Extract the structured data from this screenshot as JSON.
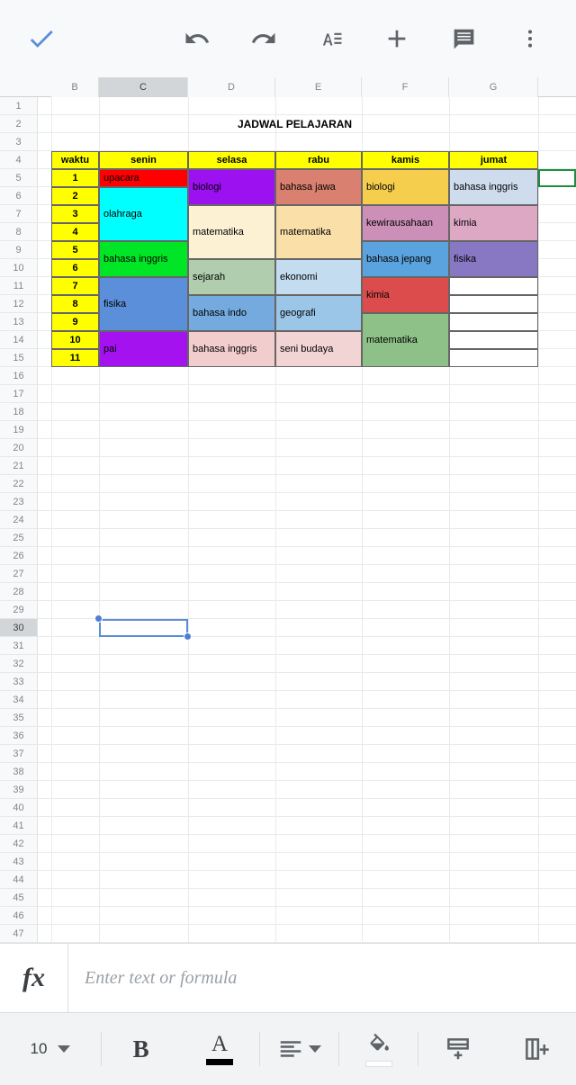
{
  "topbar": {
    "confirm_label": "check-icon",
    "actions": [
      {
        "name": "undo",
        "label": "undo-icon"
      },
      {
        "name": "redo",
        "label": "redo-icon"
      },
      {
        "name": "format",
        "label": "text-format-icon"
      },
      {
        "name": "insert",
        "label": "plus-icon"
      },
      {
        "name": "comment",
        "label": "comment-icon"
      },
      {
        "name": "more",
        "label": "more-vertical-icon"
      }
    ]
  },
  "grid": {
    "columns": [
      "B",
      "C",
      "D",
      "E",
      "F",
      "G"
    ],
    "selected_column": "C",
    "selected_row": 30,
    "first_row": 1,
    "last_row": 47,
    "title": "JADWAL PELAJARAN",
    "title_row": 2,
    "active_cell_ref": "H5"
  },
  "schedule": {
    "headers": [
      "waktu",
      "senin",
      "selasa",
      "rabu",
      "kamis",
      "jumat"
    ],
    "header_bg": "#ffff00",
    "periods": [
      "1",
      "2",
      "3",
      "4",
      "5",
      "6",
      "7",
      "8",
      "9",
      "10",
      "11"
    ],
    "period_bg": "#ffff00",
    "columns": [
      {
        "day": "senin",
        "blocks": [
          {
            "text": "upacara",
            "start": 1,
            "span": 1,
            "bg": "#ff0000"
          },
          {
            "text": "olahraga",
            "start": 2,
            "span": 3,
            "bg": "#00ffff"
          },
          {
            "text": "bahasa inggris",
            "start": 5,
            "span": 2,
            "bg": "#00e525"
          },
          {
            "text": "fisika",
            "start": 7,
            "span": 3,
            "bg": "#5b8fd9"
          },
          {
            "text": "pai",
            "start": 10,
            "span": 2,
            "bg": "#a512f0"
          }
        ]
      },
      {
        "day": "selasa",
        "blocks": [
          {
            "text": "biologi",
            "start": 1,
            "span": 2,
            "bg": "#9b11f0"
          },
          {
            "text": "matematika",
            "start": 3,
            "span": 3,
            "bg": "#fdf1d4"
          },
          {
            "text": "sejarah",
            "start": 6,
            "span": 2,
            "bg": "#b0cdae"
          },
          {
            "text": "bahasa indo",
            "start": 8,
            "span": 2,
            "bg": "#74aade"
          },
          {
            "text": "bahasa inggris",
            "start": 10,
            "span": 2,
            "bg": "#f2cdcd"
          }
        ]
      },
      {
        "day": "rabu",
        "blocks": [
          {
            "text": "bahasa jawa",
            "start": 1,
            "span": 2,
            "bg": "#d98070"
          },
          {
            "text": "matematika",
            "start": 3,
            "span": 3,
            "bg": "#fae0a8"
          },
          {
            "text": "ekonomi",
            "start": 6,
            "span": 2,
            "bg": "#c3dcf0"
          },
          {
            "text": "geografi",
            "start": 8,
            "span": 2,
            "bg": "#9bc6e8"
          },
          {
            "text": "seni budaya",
            "start": 10,
            "span": 2,
            "bg": "#f2d4d4"
          }
        ]
      },
      {
        "day": "kamis",
        "blocks": [
          {
            "text": "biologi",
            "start": 1,
            "span": 2,
            "bg": "#f5ce4e"
          },
          {
            "text": "kewirausahaan",
            "start": 3,
            "span": 2,
            "bg": "#cc8fb8"
          },
          {
            "text": "bahasa jepang",
            "start": 5,
            "span": 2,
            "bg": "#5ba3de"
          },
          {
            "text": "kimia",
            "start": 7,
            "span": 2,
            "bg": "#dd4c4c"
          },
          {
            "text": "matematika",
            "start": 9,
            "span": 3,
            "bg": "#8ec188"
          }
        ]
      },
      {
        "day": "jumat",
        "blocks": [
          {
            "text": "bahasa inggris",
            "start": 1,
            "span": 2,
            "bg": "#cfdcee"
          },
          {
            "text": "kimia",
            "start": 3,
            "span": 2,
            "bg": "#dda8c4"
          },
          {
            "text": "fisika",
            "start": 5,
            "span": 2,
            "bg": "#8878c4"
          },
          {
            "text": "",
            "start": 7,
            "span": 1,
            "bg": "#ffffff"
          },
          {
            "text": "",
            "start": 8,
            "span": 1,
            "bg": "#ffffff"
          },
          {
            "text": "",
            "start": 9,
            "span": 1,
            "bg": "#ffffff"
          },
          {
            "text": "",
            "start": 10,
            "span": 1,
            "bg": "#ffffff"
          },
          {
            "text": "",
            "start": 11,
            "span": 1,
            "bg": "#ffffff"
          }
        ]
      }
    ]
  },
  "formula_bar": {
    "fx_label": "fx",
    "value": "",
    "placeholder": "Enter text or formula"
  },
  "bottom_toolbar": {
    "font_size": "10",
    "bold_label": "B",
    "text_color_label": "A",
    "text_color": "#000000",
    "fill_color": "#ffffff",
    "items": [
      {
        "name": "align",
        "label": "align-left-icon"
      },
      {
        "name": "fill-color",
        "label": "fill-color-icon"
      },
      {
        "name": "insert-row",
        "label": "insert-row-icon"
      },
      {
        "name": "insert-column",
        "label": "insert-column-icon"
      }
    ]
  }
}
